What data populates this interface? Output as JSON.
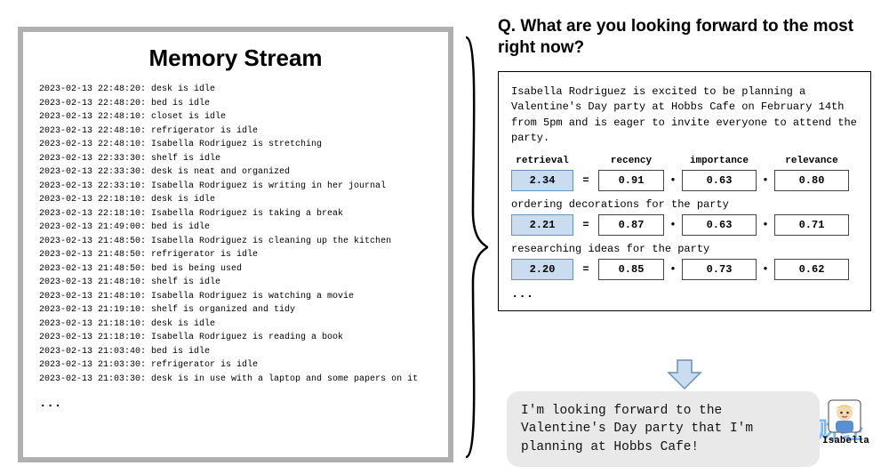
{
  "memory": {
    "title": "Memory Stream",
    "entries": [
      {
        "ts": "2023-02-13 22:48:20",
        "msg": "desk is idle"
      },
      {
        "ts": "2023-02-13 22:48:20",
        "msg": "bed is idle"
      },
      {
        "ts": "2023-02-13 22:48:10",
        "msg": "closet is idle"
      },
      {
        "ts": "2023-02-13 22:48:10",
        "msg": "refrigerator is idle"
      },
      {
        "ts": "2023-02-13 22:48:10",
        "msg": "Isabella Rodriguez is stretching"
      },
      {
        "ts": "2023-02-13 22:33:30",
        "msg": "shelf is idle"
      },
      {
        "ts": "2023-02-13 22:33:30",
        "msg": "desk is neat and organized"
      },
      {
        "ts": "2023-02-13 22:33:10",
        "msg": "Isabella Rodriguez is writing in her journal"
      },
      {
        "ts": "2023-02-13 22:18:10",
        "msg": "desk is idle"
      },
      {
        "ts": "2023-02-13 22:18:10",
        "msg": "Isabella Rodriguez is taking a break"
      },
      {
        "ts": "2023-02-13 21:49:00",
        "msg": "bed is idle"
      },
      {
        "ts": "2023-02-13 21:48:50",
        "msg": "Isabella Rodriguez is cleaning up the kitchen"
      },
      {
        "ts": "2023-02-13 21:48:50",
        "msg": "refrigerator is idle"
      },
      {
        "ts": "2023-02-13 21:48:50",
        "msg": "bed is being used"
      },
      {
        "ts": "2023-02-13 21:48:10",
        "msg": "shelf is idle"
      },
      {
        "ts": "2023-02-13 21:48:10",
        "msg": "Isabella Rodriguez is watching a movie"
      },
      {
        "ts": "2023-02-13 21:19:10",
        "msg": "shelf is organized and tidy"
      },
      {
        "ts": "2023-02-13 21:18:10",
        "msg": "desk is idle"
      },
      {
        "ts": "2023-02-13 21:18:10",
        "msg": "Isabella Rodriguez is reading a book"
      },
      {
        "ts": "2023-02-13 21:03:40",
        "msg": "bed is idle"
      },
      {
        "ts": "2023-02-13 21:03:30",
        "msg": "refrigerator is idle"
      },
      {
        "ts": "2023-02-13 21:03:30",
        "msg": "desk is in use with a laptop and some papers on it"
      }
    ],
    "ellipsis": "..."
  },
  "question": "Q. What are you looking forward to the most right now?",
  "retrieval": {
    "description": "Isabella Rodriguez is excited to be planning a Valentine's Day party at Hobbs Cafe on February 14th from 5pm and is eager to invite everyone to attend the party.",
    "headers": {
      "retrieval": "retrieval",
      "recency": "recency",
      "importance": "importance",
      "relevance": "relevance"
    },
    "rows": [
      {
        "label": "",
        "retrieval": "2.34",
        "recency": "0.91",
        "importance": "0.63",
        "relevance": "0.80"
      },
      {
        "label": "ordering decorations for the party",
        "retrieval": "2.21",
        "recency": "0.87",
        "importance": "0.63",
        "relevance": "0.71"
      },
      {
        "label": "researching ideas for the party",
        "retrieval": "2.20",
        "recency": "0.85",
        "importance": "0.73",
        "relevance": "0.62"
      }
    ],
    "ops": {
      "eq": "=",
      "plus": "•"
    },
    "ellipsis": "..."
  },
  "answer": "I'm looking forward to the Valentine's Day party that I'm planning at Hobbs Cafe!",
  "avatar": {
    "name": "Isabella"
  },
  "watermark": "白链财经"
}
